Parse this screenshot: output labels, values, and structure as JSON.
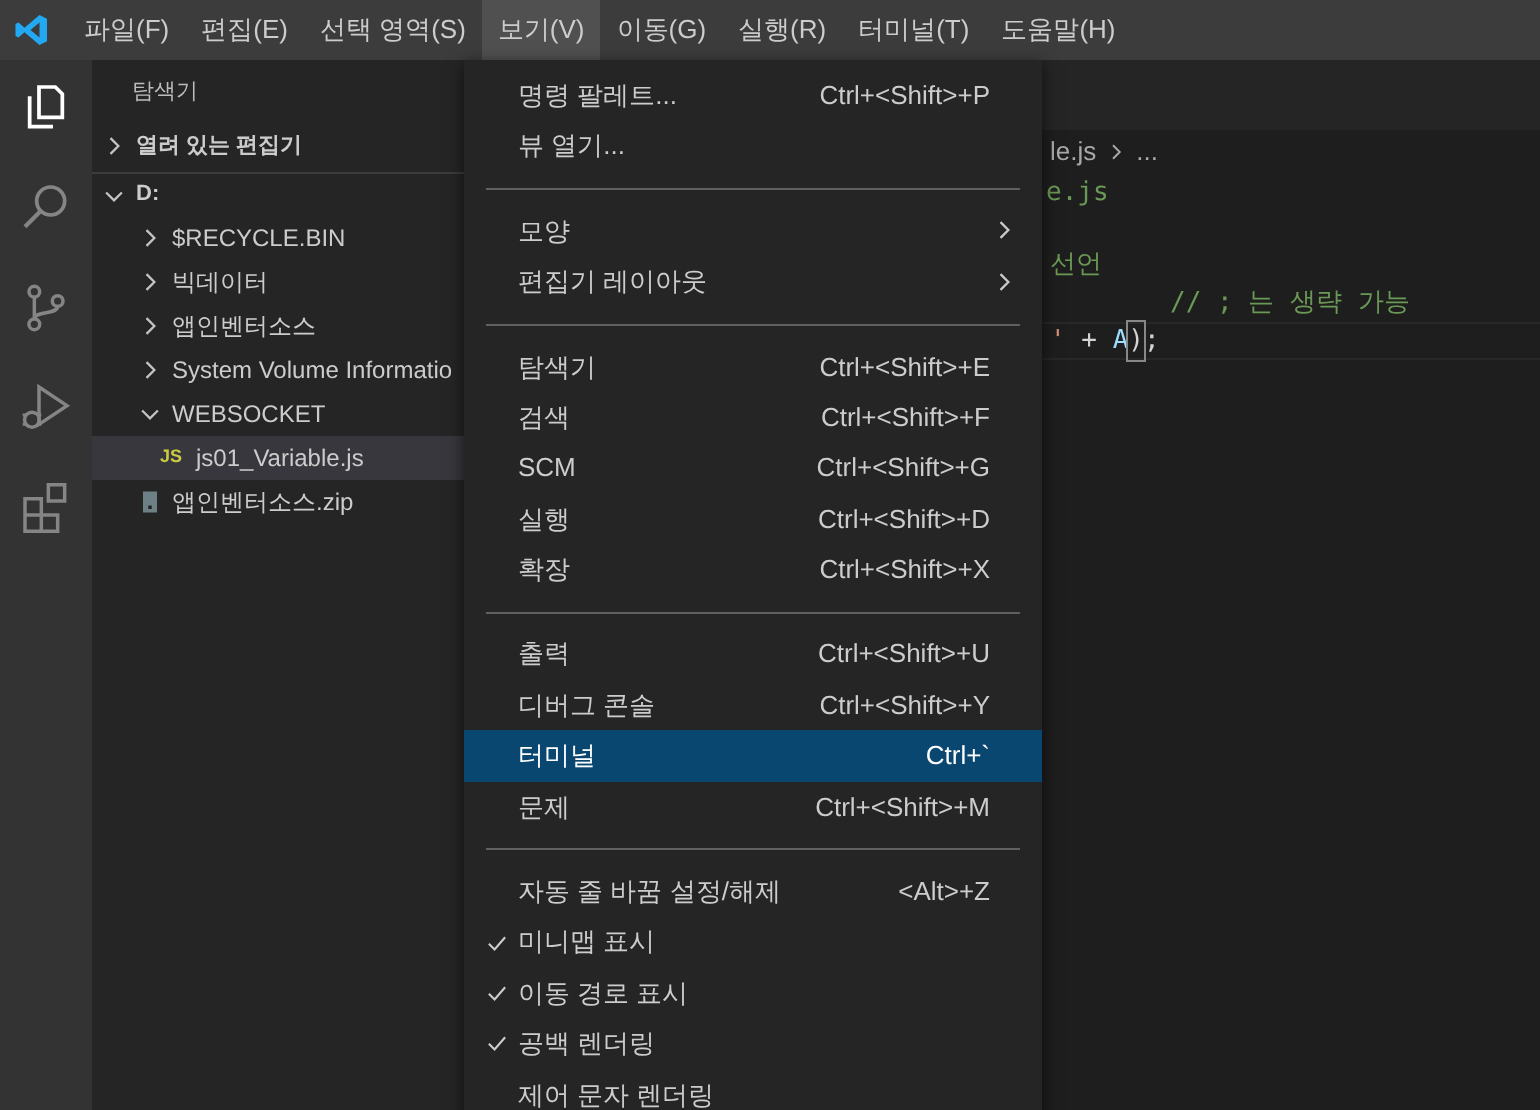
{
  "menubar": [
    {
      "label": "파일(F)",
      "selected": false
    },
    {
      "label": "편집(E)",
      "selected": false
    },
    {
      "label": "선택 영역(S)",
      "selected": false
    },
    {
      "label": "보기(V)",
      "selected": true
    },
    {
      "label": "이동(G)",
      "selected": false
    },
    {
      "label": "실행(R)",
      "selected": false
    },
    {
      "label": "터미널(T)",
      "selected": false
    },
    {
      "label": "도움말(H)",
      "selected": false
    }
  ],
  "activity_bar": [
    {
      "kind": "explorer",
      "selected": true
    },
    {
      "kind": "search",
      "selected": false
    },
    {
      "kind": "scm",
      "selected": false
    },
    {
      "kind": "debug",
      "selected": false
    },
    {
      "kind": "extensions",
      "selected": false
    }
  ],
  "sidebar": {
    "title": "탐색기",
    "sections": [
      {
        "label": "열려 있는 편집기",
        "expanded": false
      },
      {
        "label": "D:",
        "expanded": true,
        "children": [
          {
            "label": "$RECYCLE.BIN",
            "kind": "folder",
            "expanded": false,
            "selected": false
          },
          {
            "label": "빅데이터",
            "kind": "folder",
            "expanded": false,
            "selected": false
          },
          {
            "label": "앱인벤터소스",
            "kind": "folder",
            "expanded": false,
            "selected": false
          },
          {
            "label": "System Volume Informatio",
            "kind": "folder",
            "expanded": false,
            "selected": false
          },
          {
            "label": "WEBSOCKET",
            "kind": "folder",
            "expanded": true,
            "selected": false,
            "children": [
              {
                "label": "js01_Variable.js",
                "kind": "js",
                "icon_text": "JS",
                "selected": true
              }
            ]
          },
          {
            "label": "앱인벤터소스.zip",
            "kind": "zip",
            "selected": false
          }
        ]
      }
    ]
  },
  "editor": {
    "breadcrumb": [
      "le.js",
      "..."
    ],
    "lines": [
      [
        {
          "text": "e.js",
          "kind": "comment"
        }
      ],
      [
        {
          "text": "선언",
          "kind": "comment"
        }
      ],
      [
        {
          "text": "// ; 는 생략 가능",
          "kind": "comment"
        }
      ],
      [
        {
          "text": "'",
          "kind": "string"
        },
        {
          "text": " + ",
          "kind": "plain"
        },
        {
          "text": "A",
          "kind": "variable"
        },
        {
          "text": ")",
          "kind": "bracket"
        },
        {
          "text": ";",
          "kind": "plain"
        }
      ]
    ]
  },
  "menu": [
    {
      "kind": "item",
      "label": "명령 팔레트...",
      "shortcut": "Ctrl+<Shift>+P",
      "selected": false
    },
    {
      "kind": "item",
      "label": "뷰 열기...",
      "selected": false
    },
    {
      "kind": "separator"
    },
    {
      "kind": "item",
      "label": "모양",
      "submenu": true,
      "selected": false
    },
    {
      "kind": "item",
      "label": "편집기 레이아웃",
      "submenu": true,
      "selected": false
    },
    {
      "kind": "separator"
    },
    {
      "kind": "item",
      "label": "탐색기",
      "shortcut": "Ctrl+<Shift>+E",
      "selected": false
    },
    {
      "kind": "item",
      "label": "검색",
      "shortcut": "Ctrl+<Shift>+F",
      "selected": false
    },
    {
      "kind": "item",
      "label": "SCM",
      "shortcut": "Ctrl+<Shift>+G",
      "selected": false
    },
    {
      "kind": "item",
      "label": "실행",
      "shortcut": "Ctrl+<Shift>+D",
      "selected": false
    },
    {
      "kind": "item",
      "label": "확장",
      "shortcut": "Ctrl+<Shift>+X",
      "selected": false
    },
    {
      "kind": "separator"
    },
    {
      "kind": "item",
      "label": "출력",
      "shortcut": "Ctrl+<Shift>+U",
      "selected": false
    },
    {
      "kind": "item",
      "label": "디버그 콘솔",
      "shortcut": "Ctrl+<Shift>+Y",
      "selected": false
    },
    {
      "kind": "item",
      "label": "터미널",
      "shortcut": "Ctrl+`",
      "selected": true
    },
    {
      "kind": "item",
      "label": "문제",
      "shortcut": "Ctrl+<Shift>+M",
      "selected": false
    },
    {
      "kind": "separator"
    },
    {
      "kind": "item",
      "label": "자동 줄 바꿈 설정/해제",
      "shortcut": "<Alt>+Z",
      "checked": false,
      "selected": false
    },
    {
      "kind": "item",
      "label": "미니맵 표시",
      "checked": true,
      "selected": false
    },
    {
      "kind": "item",
      "label": "이동 경로 표시",
      "checked": true,
      "selected": false
    },
    {
      "kind": "item",
      "label": "공백 렌더링",
      "checked": true,
      "selected": false
    },
    {
      "kind": "item",
      "label": "제어 문자 렌더링",
      "checked": false,
      "selected": false
    }
  ]
}
